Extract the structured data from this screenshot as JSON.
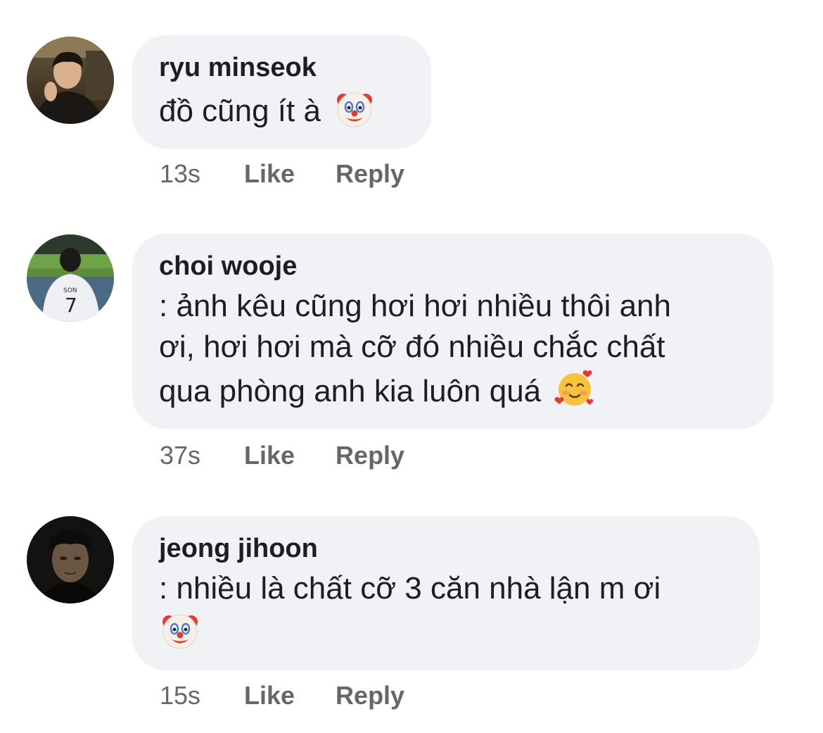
{
  "comments": [
    {
      "author": "ryu minseok",
      "lines": [
        "đồ cũng ít à"
      ],
      "emoji": "clown-face",
      "time": "13s",
      "like_label": "Like",
      "reply_label": "Reply"
    },
    {
      "author": "choi wooje",
      "lines": [
        ": ảnh kêu cũng hơi hơi nhiều thôi anh",
        "ơi, hơi hơi mà cỡ đó nhiều chắc chất",
        "qua phòng anh kia luôn quá"
      ],
      "emoji": "smiling-face-with-hearts",
      "time": "37s",
      "like_label": "Like",
      "reply_label": "Reply"
    },
    {
      "author": "jeong jihoon",
      "lines": [
        ": nhiều là chất cỡ 3 căn nhà lận m ơi"
      ],
      "emoji": "clown-face",
      "time": "15s",
      "like_label": "Like",
      "reply_label": "Reply"
    }
  ]
}
